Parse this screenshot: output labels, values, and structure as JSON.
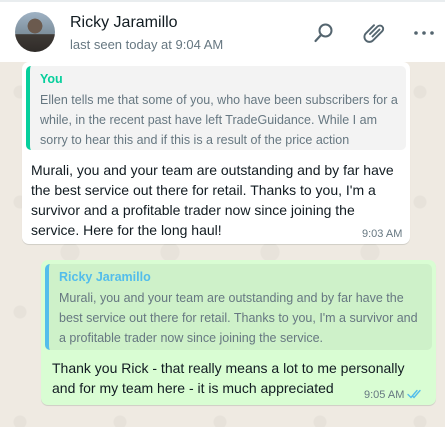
{
  "header": {
    "contact_name": "Ricky Jaramillo",
    "status": "last seen today at 9:04 AM",
    "icons": [
      "search-icon",
      "attach-icon",
      "menu-icon"
    ]
  },
  "messages": [
    {
      "direction": "incoming",
      "quote": {
        "author": "You",
        "text": "Ellen tells me that some of you, who have been subscribers for a while, in the recent past have left TradeGuidance. While I am sorry to hear this and if this is a result of the price action"
      },
      "text": "Murali, you and your team are outstanding and by far have the best service out there for retail. Thanks to you, I'm a survivor and a profitable trader now since joining the service. Here for the long haul!",
      "time": "9:03 AM"
    },
    {
      "direction": "outgoing",
      "quote": {
        "author": "Ricky Jaramillo",
        "text": "Murali, you and your team are outstanding and by far have the best service out there for retail. Thanks to you, I'm a survivor and a profitable trader now since joining the service."
      },
      "text": "Thank you Rick - that really means a lot to me personally and for my team here - it is much appreciated",
      "time": "9:05 AM",
      "read_status": "read"
    }
  ],
  "colors": {
    "outgoing_bubble": "#d9fdd3",
    "incoming_bubble": "#ffffff",
    "quote_you": "#06cf9c",
    "quote_contact": "#53bdeb",
    "read_ticks": "#53bdeb"
  }
}
